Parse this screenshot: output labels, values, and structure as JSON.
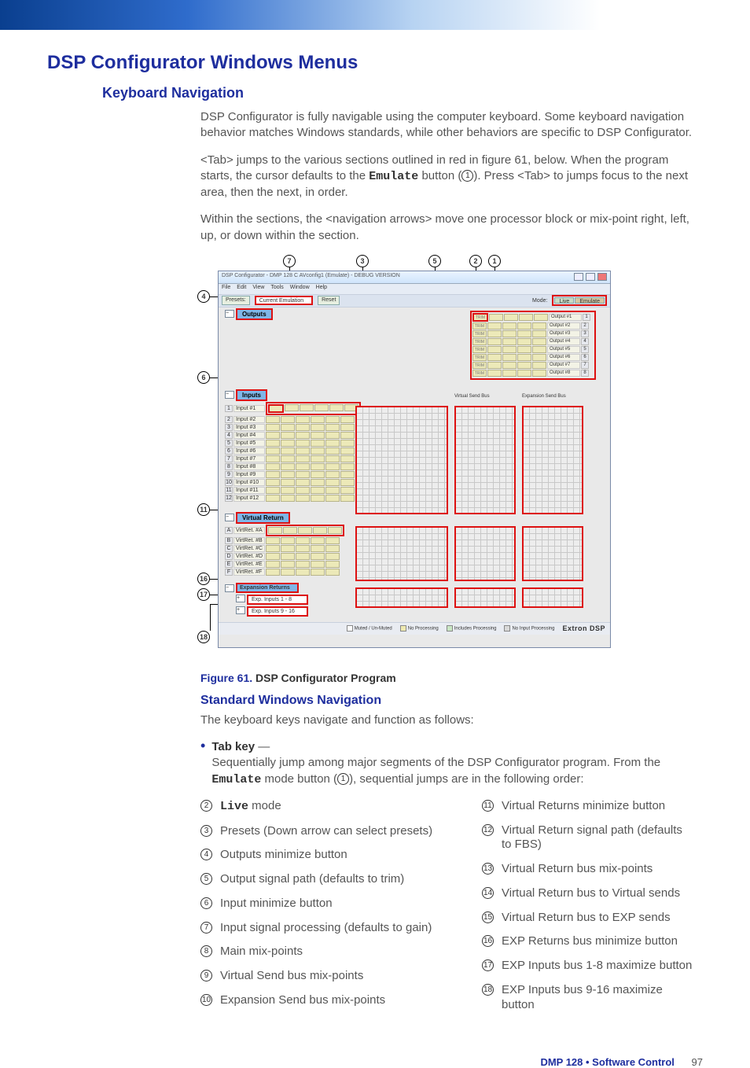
{
  "headings": {
    "h1": "DSP Configurator Windows Menus",
    "h2": "Keyboard Navigation",
    "h3": "Standard Windows Navigation"
  },
  "paras": {
    "p1": "DSP Configurator is fully navigable using the computer keyboard. Some keyboard navigation behavior matches Windows standards, while other behaviors are specific to DSP Configurator.",
    "p2a": "<Tab> jumps to the various sections outlined in red in figure 61, below. When the program starts, the cursor defaults to the ",
    "p2_mono": "Emulate",
    "p2b": " button (",
    "p2_ref": "1",
    "p2c": "). Press <Tab> to jumps focus to the next area, then the next, in order.",
    "p3": "Within the sections, the <navigation arrows> move one processor block or mix-point right, left, up, or down within the section.",
    "p4": "The keyboard keys navigate and function as follows:"
  },
  "figure": {
    "label": "Figure 61.",
    "title": "DSP Configurator Program"
  },
  "bullet": {
    "label": "Tab key",
    "dash": " — ",
    "line1": "Sequentially jump among major segments of the DSP Configurator program. From the ",
    "mono": "Emulate",
    "line2": " mode button (",
    "ref": "1",
    "line3": "), sequential jumps are in the following order:"
  },
  "listA": [
    {
      "n": "2",
      "html": "<span class=\"mono\">Live</span> mode"
    },
    {
      "n": "3",
      "text": "Presets (Down arrow can select presets)"
    },
    {
      "n": "4",
      "text": "Outputs minimize button"
    },
    {
      "n": "5",
      "text": "Output signal path (defaults to trim)"
    },
    {
      "n": "6",
      "text": "Input minimize button"
    },
    {
      "n": "7",
      "text": "Input signal processing (defaults to gain)"
    },
    {
      "n": "8",
      "text": "Main mix-points"
    },
    {
      "n": "9",
      "text": "Virtual Send bus mix-points"
    },
    {
      "n": "10",
      "text": "Expansion Send bus mix-points"
    }
  ],
  "listB": [
    {
      "n": "11",
      "text": "Virtual Returns minimize button"
    },
    {
      "n": "12",
      "text": "Virtual Return signal path (defaults to FBS)"
    },
    {
      "n": "13",
      "text": "Virtual Return bus mix-points"
    },
    {
      "n": "14",
      "text": "Virtual Return bus to Virtual sends"
    },
    {
      "n": "15",
      "text": "Virtual Return bus to EXP sends"
    },
    {
      "n": "16",
      "text": "EXP Returns bus minimize button"
    },
    {
      "n": "17",
      "text": "EXP Inputs bus 1-8 maximize button"
    },
    {
      "n": "18",
      "text": "EXP Inputs bus 9-16 maximize button"
    }
  ],
  "shot": {
    "title": "DSP Configurator - DMP 128 C AVconfig1 (Emulate) - DEBUG VERSION",
    "menus": [
      "File",
      "Edit",
      "View",
      "Tools",
      "Window",
      "Help"
    ],
    "toolbar": {
      "presets": "Presets:",
      "dropdown": "Current Emulation",
      "reset": "Reset",
      "mode_label": "Mode:",
      "live": "Live",
      "emulate": "Emulate"
    },
    "outputs_label": "Outputs",
    "inputs_label": "Inputs",
    "vr_label": "Virtual Return",
    "exp_label": "Expansion Returns",
    "exp1": "Exp. Inputs 1 - 8",
    "exp2": "Exp. Inputs 9 - 16",
    "buses": {
      "vsend": "Virtual Send Bus",
      "esend": "Expansion Send Bus"
    },
    "outputs": [
      {
        "n": "1",
        "name": "Output #1"
      },
      {
        "n": "2",
        "name": "Output #2"
      },
      {
        "n": "3",
        "name": "Output #3"
      },
      {
        "n": "4",
        "name": "Output #4"
      },
      {
        "n": "5",
        "name": "Output #5"
      },
      {
        "n": "6",
        "name": "Output #6"
      },
      {
        "n": "7",
        "name": "Output #7"
      },
      {
        "n": "8",
        "name": "Output #8"
      }
    ],
    "inputs": [
      {
        "n": "1",
        "name": "Input #1"
      },
      {
        "n": "2",
        "name": "Input #2"
      },
      {
        "n": "3",
        "name": "Input #3"
      },
      {
        "n": "4",
        "name": "Input #4"
      },
      {
        "n": "5",
        "name": "Input #5"
      },
      {
        "n": "6",
        "name": "Input #6"
      },
      {
        "n": "7",
        "name": "Input #7"
      },
      {
        "n": "8",
        "name": "Input #8"
      },
      {
        "n": "9",
        "name": "Input #9"
      },
      {
        "n": "10",
        "name": "Input #10"
      },
      {
        "n": "11",
        "name": "Input #11"
      },
      {
        "n": "12",
        "name": "Input #12"
      }
    ],
    "vreturns": [
      {
        "n": "A",
        "name": "VirtRet. #A"
      },
      {
        "n": "B",
        "name": "VirtRet. #B"
      },
      {
        "n": "C",
        "name": "VirtRet. #C"
      },
      {
        "n": "D",
        "name": "VirtRet. #D"
      },
      {
        "n": "E",
        "name": "VirtRet. #E"
      },
      {
        "n": "F",
        "name": "VirtRet. #F"
      }
    ],
    "legend": {
      "l1": "Muted / Un-Muted",
      "l2": "No Processing",
      "l3": "Includes Processing",
      "l4": "No Input Processing",
      "dsp": "Extron DSP"
    }
  },
  "callouts": {
    "1": "1",
    "2": "2",
    "3": "3",
    "4": "4",
    "5": "5",
    "6": "6",
    "7": "7",
    "8": "8",
    "9": "9",
    "10": "10",
    "11": "11",
    "12": "12",
    "13": "13",
    "14": "14",
    "15": "15",
    "16": "16",
    "17": "17",
    "18": "18"
  },
  "footer": {
    "text": "DMP 128 • Software Control",
    "page": "97"
  }
}
